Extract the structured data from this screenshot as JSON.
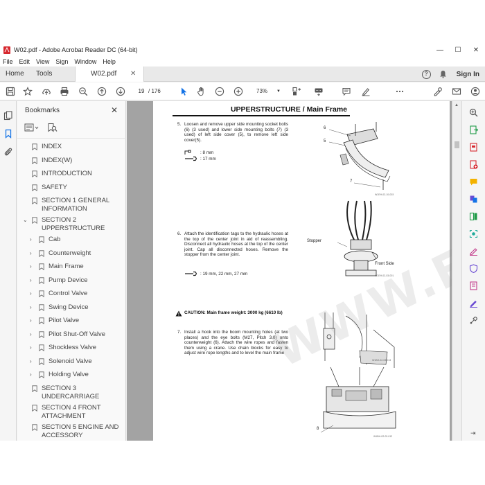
{
  "window": {
    "title": "W02.pdf - Adobe Acrobat Reader DC (64-bit)",
    "minimize": "—",
    "maximize": "☐",
    "close": "✕"
  },
  "menu": [
    "File",
    "Edit",
    "View",
    "Sign",
    "Window",
    "Help"
  ],
  "tabs": {
    "home": "Home",
    "tools": "Tools",
    "doc": "W02.pdf",
    "close": "✕",
    "help": "?",
    "signin": "Sign In"
  },
  "toolbar": {
    "page_current": "19",
    "page_total": "/ 176",
    "zoom": "73%",
    "zoom_caret": "▼",
    "icons": [
      "save-icon",
      "star-icon",
      "upload-icon",
      "print-icon",
      "zoom-search-icon",
      "page-up-icon",
      "page-down-icon",
      "select-cursor-icon",
      "hand-icon",
      "zoom-out-icon",
      "zoom-in-icon",
      "fit-page-icon",
      "keyboard-icon",
      "comment-icon",
      "pen-icon",
      "more-icon",
      "share-sign-icon",
      "mail-icon",
      "account-icon"
    ]
  },
  "bookmarks": {
    "title": "Bookmarks",
    "close": "✕",
    "items": [
      {
        "label": "INDEX",
        "level": 0,
        "expand": ""
      },
      {
        "label": "INDEX(W)",
        "level": 0,
        "expand": ""
      },
      {
        "label": "INTRODUCTION",
        "level": 0,
        "expand": ""
      },
      {
        "label": "SAFETY",
        "level": 0,
        "expand": ""
      },
      {
        "label": "SECTION 1 GENERAL INFORMATION",
        "level": 0,
        "expand": ""
      },
      {
        "label": "SECTION 2 UPPERSTRUCTURE",
        "level": 0,
        "expand": "⌄"
      },
      {
        "label": "Cab",
        "level": 1,
        "expand": "›"
      },
      {
        "label": "Counterweight",
        "level": 1,
        "expand": "›"
      },
      {
        "label": "Main Frame",
        "level": 1,
        "expand": "›"
      },
      {
        "label": "Pump Device",
        "level": 1,
        "expand": "›"
      },
      {
        "label": "Control Valve",
        "level": 1,
        "expand": "›"
      },
      {
        "label": "Swing Device",
        "level": 1,
        "expand": "›"
      },
      {
        "label": "Pilot Valve",
        "level": 1,
        "expand": "›"
      },
      {
        "label": "Pilot Shut-Off Valve",
        "level": 1,
        "expand": "›"
      },
      {
        "label": "Shockless Valve",
        "level": 1,
        "expand": "›"
      },
      {
        "label": "Solenoid Valve",
        "level": 1,
        "expand": "›"
      },
      {
        "label": "Holding Valve",
        "level": 1,
        "expand": "›"
      },
      {
        "label": "SECTION 3 UNDERCARRIAGE",
        "level": 0,
        "expand": ""
      },
      {
        "label": "SECTION 4 FRONT ATTACHMENT",
        "level": 0,
        "expand": ""
      },
      {
        "label": "SECTION 5 ENGINE AND ACCESSORY",
        "level": 0,
        "expand": ""
      }
    ]
  },
  "document": {
    "header": "UPPERSTRUCTURE / Main Frame",
    "steps": [
      {
        "num": "5.",
        "text": "Loosen and remove upper side mounting socket bolts (6) (3 used) and lower side mounting bolts (7) (3 used) of left side cover (5), to remove left side cover(5)."
      },
      {
        "num": "6.",
        "text": "Attach the identification tags to the hydraulic hoses at the top of the center joint in aid of reassembling. Disconnect all hydraulic hoses at the top of the center joint. Cap all disconnected hoses. Remove the stopper from the center joint."
      },
      {
        "num": "7.",
        "text": "Install a hook into the boom mounting holes (at two places) and the eye bolts (M27, Pitch 3.0) onto counterweight (6). Attach the wire ropes and fasten them using a crane. Use chain blocks for easy to adjust wire rope lengths and to level the main frame"
      }
    ],
    "tool1": {
      "size1": ": 8 mm",
      "size2": ": 17 mm"
    },
    "tool2": {
      "sizes": ": 19 mm, 22 mm, 27 mm"
    },
    "caution": {
      "label": "CAUTION:",
      "text": "Main frame weight: 3000 kg (6610 lb)"
    },
    "fig1": {
      "labels": [
        "6",
        "5",
        "7"
      ],
      "caption": "W1EH-02-10-003"
    },
    "fig2": {
      "labels": [
        "Stopper",
        "Front Side"
      ],
      "caption": "W1EH-02-03-001"
    },
    "fig3": {
      "caption": "W1BH-02-03-013"
    },
    "fig4": {
      "labels": [
        "8"
      ],
      "caption": "W1BH-02-03-012"
    }
  },
  "watermark": "WWW.EPCDEPO.COM",
  "colors": {
    "accent": "#1473e6",
    "pdf_red": "#d7282f"
  }
}
